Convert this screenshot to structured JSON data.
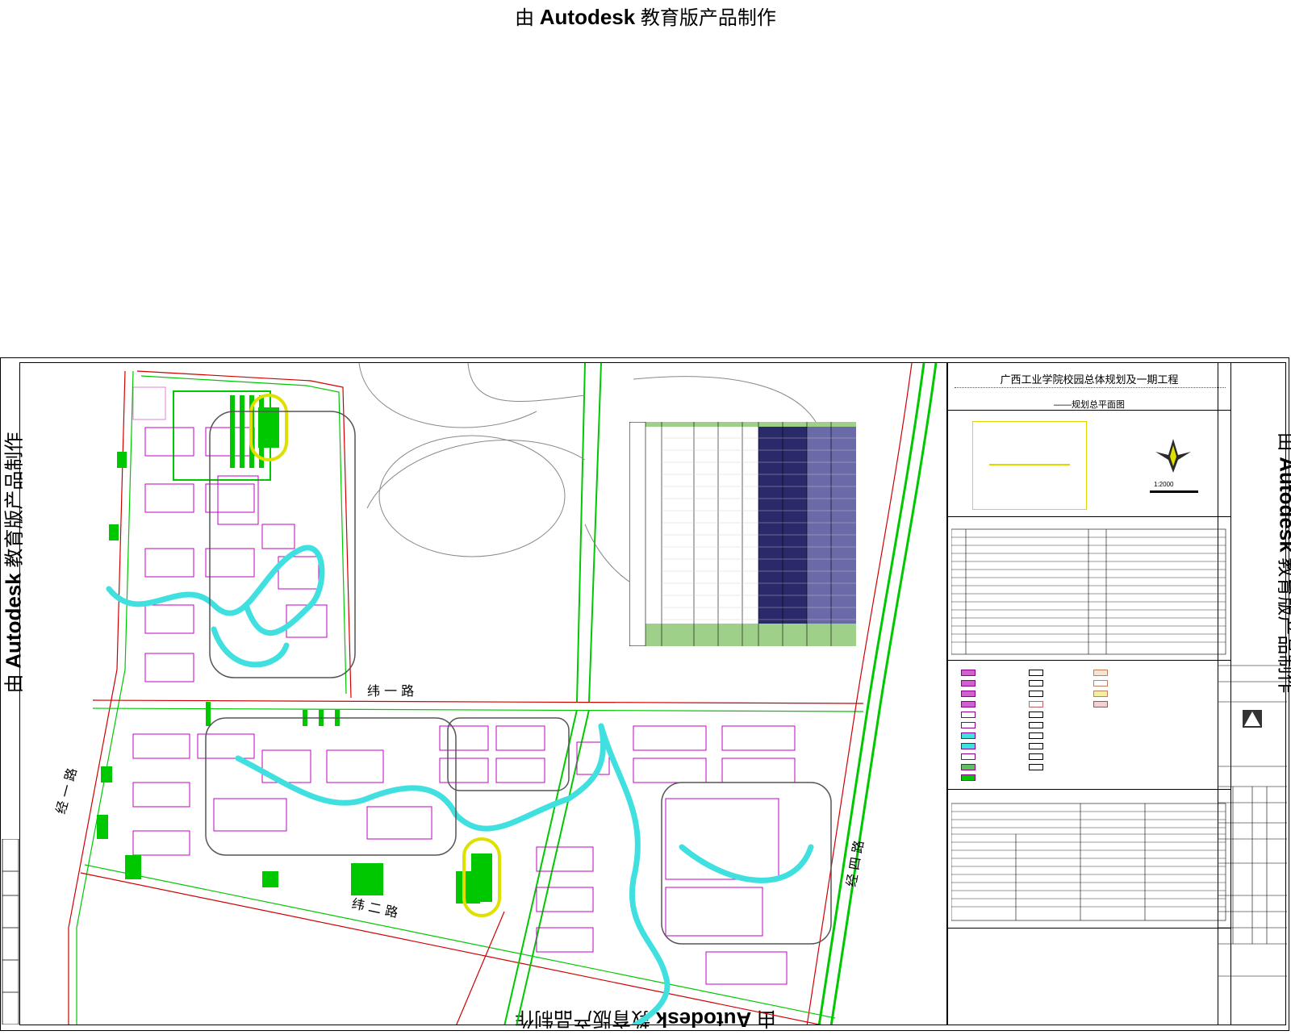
{
  "watermark": {
    "prefix": "由",
    "brand": "Autodesk",
    "suffix": "教育版产品制作"
  },
  "title_block": {
    "project_title": "广西工业学院校园总体规划及一期工程",
    "sheet_title": "——规划总平面图",
    "scale": "1:2000"
  },
  "road_labels": {
    "weiyi": "纬  一  路",
    "jingyi": "经  一  路",
    "jingsi": "经  四  路",
    "weier": "纬  二  路"
  },
  "colors": {
    "green": "#00c800",
    "magenta": "#c000c0",
    "cyan": "#40e0e0",
    "red": "#d00000",
    "yellow": "#e0e000",
    "navy": "#2a2a6a"
  }
}
